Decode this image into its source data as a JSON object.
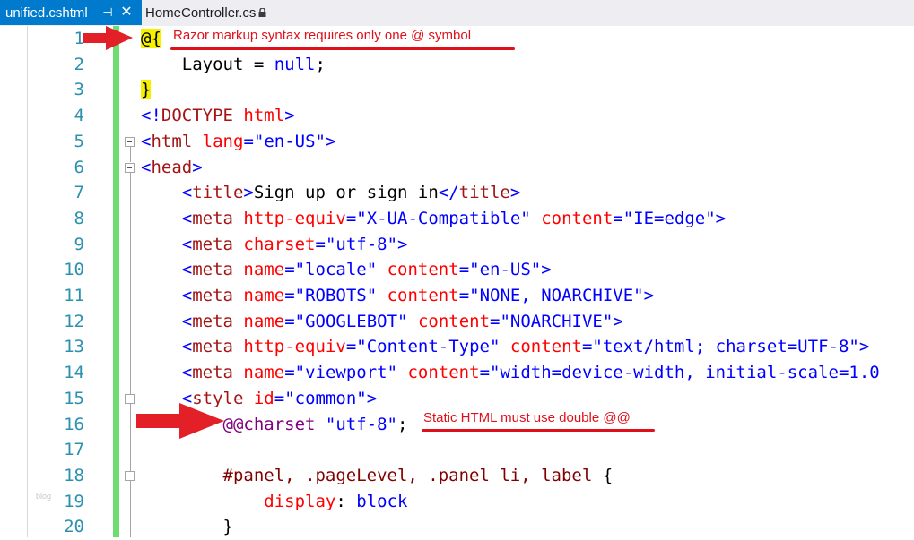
{
  "tabs": [
    {
      "label": "unified.cshtml",
      "active": true,
      "icons": [
        "pin-icon",
        "close-icon"
      ]
    },
    {
      "label": "HomeController.cs",
      "active": false,
      "icons": [
        "lock-icon"
      ]
    }
  ],
  "watermark": "blog",
  "line_numbers": [
    "1",
    "2",
    "3",
    "4",
    "5",
    "6",
    "7",
    "8",
    "9",
    "10",
    "11",
    "12",
    "13",
    "14",
    "15",
    "16",
    "17",
    "18",
    "19",
    "20"
  ],
  "code": [
    [
      {
        "t": "@{",
        "c": "razor"
      }
    ],
    [
      {
        "t": "    Layout = ",
        "c": "plain"
      },
      {
        "t": "null",
        "c": "kw"
      },
      {
        "t": ";",
        "c": "plain"
      }
    ],
    [
      {
        "t": "}",
        "c": "razor"
      }
    ],
    [
      {
        "t": "<!",
        "c": "punct"
      },
      {
        "t": "DOCTYPE",
        "c": "tag"
      },
      {
        "t": " ",
        "c": "plain"
      },
      {
        "t": "html",
        "c": "attr"
      },
      {
        "t": ">",
        "c": "punct"
      }
    ],
    [
      {
        "t": "<",
        "c": "punct"
      },
      {
        "t": "html",
        "c": "tag"
      },
      {
        "t": " ",
        "c": "plain"
      },
      {
        "t": "lang",
        "c": "attr"
      },
      {
        "t": "=",
        "c": "punct"
      },
      {
        "t": "\"en-US\"",
        "c": "str"
      },
      {
        "t": ">",
        "c": "punct"
      }
    ],
    [
      {
        "t": "<",
        "c": "punct"
      },
      {
        "t": "head",
        "c": "tag"
      },
      {
        "t": ">",
        "c": "punct"
      }
    ],
    [
      {
        "t": "    <",
        "c": "punct"
      },
      {
        "t": "title",
        "c": "tag"
      },
      {
        "t": ">",
        "c": "punct"
      },
      {
        "t": "Sign up or sign in",
        "c": "plain"
      },
      {
        "t": "</",
        "c": "punct"
      },
      {
        "t": "title",
        "c": "tag"
      },
      {
        "t": ">",
        "c": "punct"
      }
    ],
    [
      {
        "t": "    <",
        "c": "punct"
      },
      {
        "t": "meta",
        "c": "tag"
      },
      {
        "t": " ",
        "c": "plain"
      },
      {
        "t": "http-equiv",
        "c": "attr"
      },
      {
        "t": "=",
        "c": "punct"
      },
      {
        "t": "\"X-UA-Compatible\"",
        "c": "str"
      },
      {
        "t": " ",
        "c": "plain"
      },
      {
        "t": "content",
        "c": "attr"
      },
      {
        "t": "=",
        "c": "punct"
      },
      {
        "t": "\"IE=edge\"",
        "c": "str"
      },
      {
        "t": ">",
        "c": "punct"
      }
    ],
    [
      {
        "t": "    <",
        "c": "punct"
      },
      {
        "t": "meta",
        "c": "tag"
      },
      {
        "t": " ",
        "c": "plain"
      },
      {
        "t": "charset",
        "c": "attr"
      },
      {
        "t": "=",
        "c": "punct"
      },
      {
        "t": "\"utf-8\"",
        "c": "str"
      },
      {
        "t": ">",
        "c": "punct"
      }
    ],
    [
      {
        "t": "    <",
        "c": "punct"
      },
      {
        "t": "meta",
        "c": "tag"
      },
      {
        "t": " ",
        "c": "plain"
      },
      {
        "t": "name",
        "c": "attr"
      },
      {
        "t": "=",
        "c": "punct"
      },
      {
        "t": "\"locale\"",
        "c": "str"
      },
      {
        "t": " ",
        "c": "plain"
      },
      {
        "t": "content",
        "c": "attr"
      },
      {
        "t": "=",
        "c": "punct"
      },
      {
        "t": "\"en-US\"",
        "c": "str"
      },
      {
        "t": ">",
        "c": "punct"
      }
    ],
    [
      {
        "t": "    <",
        "c": "punct"
      },
      {
        "t": "meta",
        "c": "tag"
      },
      {
        "t": " ",
        "c": "plain"
      },
      {
        "t": "name",
        "c": "attr"
      },
      {
        "t": "=",
        "c": "punct"
      },
      {
        "t": "\"ROBOTS\"",
        "c": "str"
      },
      {
        "t": " ",
        "c": "plain"
      },
      {
        "t": "content",
        "c": "attr"
      },
      {
        "t": "=",
        "c": "punct"
      },
      {
        "t": "\"NONE, NOARCHIVE\"",
        "c": "str"
      },
      {
        "t": ">",
        "c": "punct"
      }
    ],
    [
      {
        "t": "    <",
        "c": "punct"
      },
      {
        "t": "meta",
        "c": "tag"
      },
      {
        "t": " ",
        "c": "plain"
      },
      {
        "t": "name",
        "c": "attr"
      },
      {
        "t": "=",
        "c": "punct"
      },
      {
        "t": "\"GOOGLEBOT\"",
        "c": "str"
      },
      {
        "t": " ",
        "c": "plain"
      },
      {
        "t": "content",
        "c": "attr"
      },
      {
        "t": "=",
        "c": "punct"
      },
      {
        "t": "\"NOARCHIVE\"",
        "c": "str"
      },
      {
        "t": ">",
        "c": "punct"
      }
    ],
    [
      {
        "t": "    <",
        "c": "punct"
      },
      {
        "t": "meta",
        "c": "tag"
      },
      {
        "t": " ",
        "c": "plain"
      },
      {
        "t": "http-equiv",
        "c": "attr"
      },
      {
        "t": "=",
        "c": "punct"
      },
      {
        "t": "\"Content-Type\"",
        "c": "str"
      },
      {
        "t": " ",
        "c": "plain"
      },
      {
        "t": "content",
        "c": "attr"
      },
      {
        "t": "=",
        "c": "punct"
      },
      {
        "t": "\"text/html; charset=UTF-8\"",
        "c": "str"
      },
      {
        "t": ">",
        "c": "punct"
      }
    ],
    [
      {
        "t": "    <",
        "c": "punct"
      },
      {
        "t": "meta",
        "c": "tag"
      },
      {
        "t": " ",
        "c": "plain"
      },
      {
        "t": "name",
        "c": "attr"
      },
      {
        "t": "=",
        "c": "punct"
      },
      {
        "t": "\"viewport\"",
        "c": "str"
      },
      {
        "t": " ",
        "c": "plain"
      },
      {
        "t": "content",
        "c": "attr"
      },
      {
        "t": "=",
        "c": "punct"
      },
      {
        "t": "\"width=device-width, initial-scale=1.0",
        "c": "str"
      }
    ],
    [
      {
        "t": "    <",
        "c": "punct"
      },
      {
        "t": "style",
        "c": "tag"
      },
      {
        "t": " ",
        "c": "plain"
      },
      {
        "t": "id",
        "c": "attr"
      },
      {
        "t": "=",
        "c": "punct"
      },
      {
        "t": "\"common\"",
        "c": "str"
      },
      {
        "t": ">",
        "c": "punct"
      }
    ],
    [
      {
        "t": "        ",
        "c": "plain"
      },
      {
        "t": "@@charset",
        "c": "at"
      },
      {
        "t": " ",
        "c": "plain"
      },
      {
        "t": "\"utf-8\"",
        "c": "str"
      },
      {
        "t": ";",
        "c": "plain"
      }
    ],
    [],
    [
      {
        "t": "        #panel, .pageLevel, .panel li, label ",
        "c": "sel"
      },
      {
        "t": "{",
        "c": "plain"
      }
    ],
    [
      {
        "t": "            ",
        "c": "plain"
      },
      {
        "t": "display",
        "c": "prop"
      },
      {
        "t": ": ",
        "c": "plain"
      },
      {
        "t": "block",
        "c": "val"
      }
    ],
    [
      {
        "t": "        }",
        "c": "plain"
      }
    ]
  ],
  "annotations": [
    {
      "text": "Razor markup syntax requires only one @ symbol",
      "color": "#e0101a"
    },
    {
      "text": "Static HTML must use double @@",
      "color": "#e0101a"
    }
  ]
}
